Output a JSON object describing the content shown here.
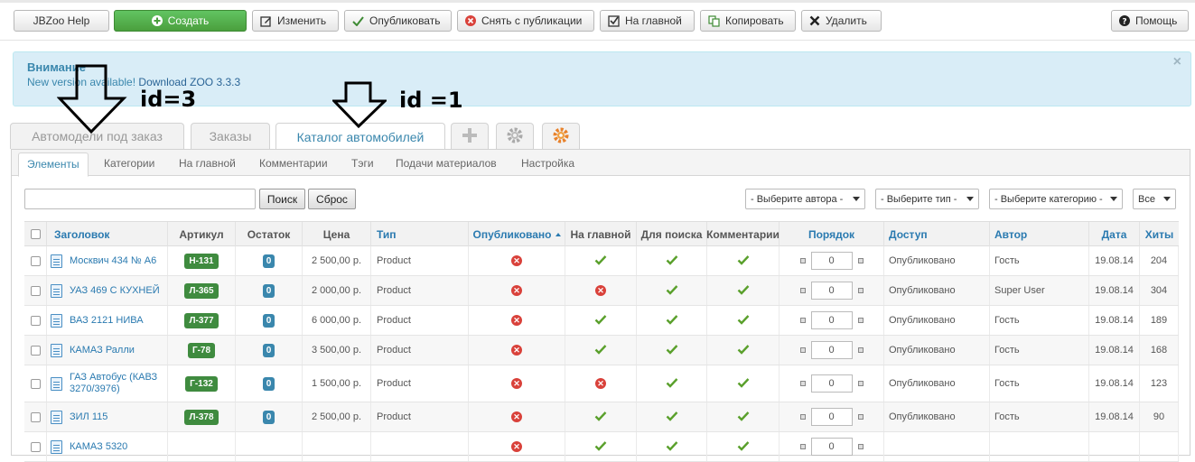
{
  "toolbar": {
    "help_label": "JBZoo Help",
    "create_label": "Создать",
    "edit_label": "Изменить",
    "publish_label": "Опубликовать",
    "unpublish_label": "Снять с публикации",
    "frontpage_label": "На главной",
    "copy_label": "Копировать",
    "delete_label": "Удалить",
    "info_label": "Помощь"
  },
  "alert": {
    "title": "Внимание",
    "text_prefix": "New version available! ",
    "link": "Download ZOO 3.3.3",
    "close": "×"
  },
  "app_tabs": [
    "Автомодели под заказ",
    "Заказы",
    "Каталог автомобилей"
  ],
  "sub_tabs": [
    "Элементы",
    "Категории",
    "На главной",
    "Комментарии",
    "Тэги",
    "Подачи материалов",
    "Настройка"
  ],
  "filters": {
    "search_value": "",
    "search_button": "Поиск",
    "reset_button": "Сброс",
    "author": "- Выберите автора -",
    "type": "- Выберите тип -",
    "category": "- Выберите категорию -",
    "limit": "Все"
  },
  "columns": [
    "Заголовок",
    "Артикул",
    "Остаток",
    "Цена",
    "Тип",
    "Опубликовано",
    "На главной",
    "Для поиска",
    "Комментарии",
    "Порядок",
    "Доступ",
    "Автор",
    "Дата",
    "Хиты"
  ],
  "rows": [
    {
      "title": "Москвич 434 № А6",
      "sku": "Н-131",
      "stock": "0",
      "price": "2 500,00 р.",
      "type": "Product",
      "published": false,
      "frontpage": true,
      "searchable": true,
      "comments": true,
      "order": "0",
      "access": "Опубликовано",
      "author": "Гость",
      "date": "19.08.14",
      "hits": "204"
    },
    {
      "title": "УАЗ 469 С КУХНЕЙ",
      "sku": "Л-365",
      "stock": "0",
      "price": "2 000,00 р.",
      "type": "Product",
      "published": false,
      "frontpage": false,
      "searchable": true,
      "comments": true,
      "order": "0",
      "access": "Опубликовано",
      "author": "Super User",
      "date": "19.08.14",
      "hits": "304"
    },
    {
      "title": "ВАЗ 2121 НИВА",
      "sku": "Л-377",
      "stock": "0",
      "price": "6 000,00 р.",
      "type": "Product",
      "published": false,
      "frontpage": true,
      "searchable": true,
      "comments": true,
      "order": "0",
      "access": "Опубликовано",
      "author": "Гость",
      "date": "19.08.14",
      "hits": "189"
    },
    {
      "title": "КАМАЗ Ралли",
      "sku": "Г-78",
      "stock": "0",
      "price": "3 500,00 р.",
      "type": "Product",
      "published": false,
      "frontpage": true,
      "searchable": true,
      "comments": true,
      "order": "0",
      "access": "Опубликовано",
      "author": "Гость",
      "date": "19.08.14",
      "hits": "168"
    },
    {
      "title": "ГАЗ Автобус (КАВЗ 3270/3976)",
      "sku": "Г-132",
      "stock": "0",
      "price": "1 500,00 р.",
      "type": "Product",
      "published": false,
      "frontpage": false,
      "searchable": true,
      "comments": true,
      "order": "0",
      "access": "Опубликовано",
      "author": "Гость",
      "date": "19.08.14",
      "hits": "123"
    },
    {
      "title": "ЗИЛ 115",
      "sku": "Л-378",
      "stock": "0",
      "price": "2 500,00 р.",
      "type": "Product",
      "published": false,
      "frontpage": true,
      "searchable": true,
      "comments": true,
      "order": "0",
      "access": "Опубликовано",
      "author": "Гость",
      "date": "19.08.14",
      "hits": "90"
    },
    {
      "title": "КАМАЗ 5320",
      "sku": "",
      "stock": "",
      "price": "",
      "type": "",
      "published": false,
      "frontpage": true,
      "searchable": true,
      "comments": true,
      "order": "0",
      "access": "",
      "author": "",
      "date": "",
      "hits": ""
    }
  ],
  "annotations": [
    "id=3",
    "id =1"
  ],
  "colors": {
    "accent": "#3a87ad",
    "create_green": "#51a351",
    "badge_green": "#3f8b3f",
    "alert_bg": "#d9edf7"
  }
}
